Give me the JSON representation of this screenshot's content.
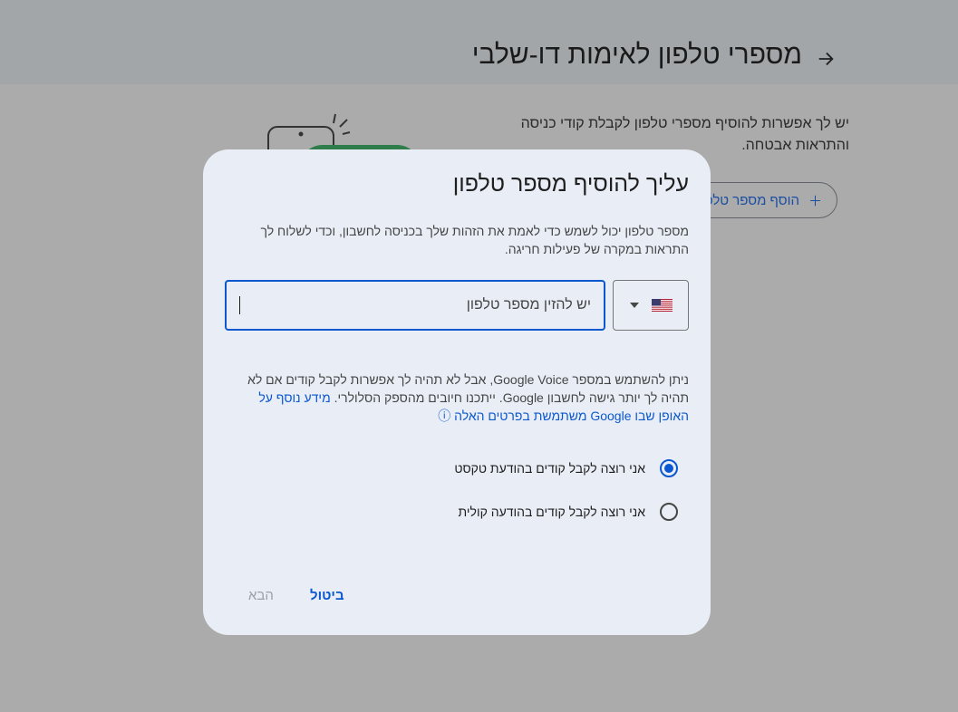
{
  "page": {
    "title": "מספרי טלפון לאימות דו-שלבי",
    "intro": "יש לך אפשרות להוסיף מספרי טלפון לקבלת קודי כניסה והתראות אבטחה.",
    "add_button_label": "הוסף מספר טלפון"
  },
  "dialog": {
    "title": "עליך להוסיף מספר טלפון",
    "description": "מספר טלפון יכול לשמש כדי לאמת את הזהות שלך בכניסה לחשבון, וכדי לשלוח לך התראות במקרה של פעילות חריגה.",
    "country_flag": "US",
    "phone_placeholder": "יש להזין מספר טלפון",
    "note_text": "ניתן להשתמש במספר Google Voice, אבל לא תהיה לך אפשרות לקבל קודים אם לא תהיה לך יותר גישה לחשבון Google. ייתכנו חיובים מהספק הסלולרי.",
    "note_link": "מידע נוסף על האופן שבו Google משתמשת בפרטים האלה",
    "radio_options": [
      {
        "label": "אני רוצה לקבל קודים בהודעת טקסט",
        "checked": true
      },
      {
        "label": "אני רוצה לקבל קודים בהודעה קולית",
        "checked": false
      }
    ],
    "cancel_label": "ביטול",
    "next_label": "הבא"
  },
  "colors": {
    "accent": "#0b57d0",
    "dialog_bg": "#e9eef6",
    "scrim": "#ababab"
  }
}
